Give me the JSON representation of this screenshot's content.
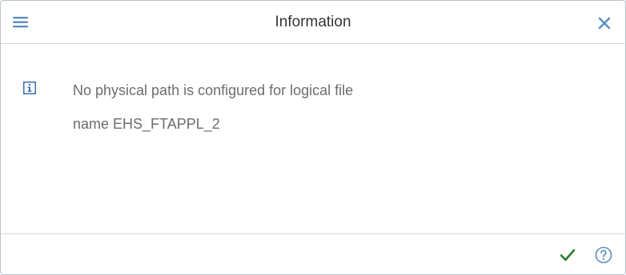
{
  "dialog": {
    "title": "Information",
    "message_line1": "No physical path is configured for logical file",
    "message_line2": "name EHS_FTAPPL_2"
  },
  "icons": {
    "menu": "hamburger-menu-icon",
    "close": "close-icon",
    "info": "info-icon",
    "confirm": "checkmark-icon",
    "help": "help-icon"
  },
  "colors": {
    "accent": "#5b8dbe",
    "confirm": "#2b7c2b",
    "text": "#6a6d70",
    "title": "#32363a"
  }
}
